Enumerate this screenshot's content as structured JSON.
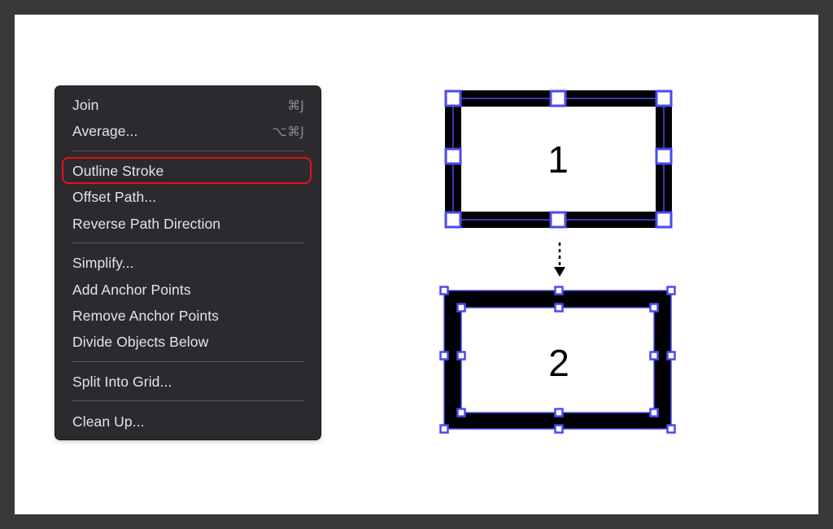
{
  "context_menu": {
    "items": [
      {
        "label": "Join",
        "shortcut": "⌘J"
      },
      {
        "label": "Average...",
        "shortcut": "⌥⌘J"
      },
      {
        "label": "Outline Stroke",
        "shortcut": "",
        "highlighted": true
      },
      {
        "label": "Offset Path...",
        "shortcut": ""
      },
      {
        "label": "Reverse Path Direction",
        "shortcut": ""
      },
      {
        "label": "Simplify...",
        "shortcut": ""
      },
      {
        "label": "Add Anchor Points",
        "shortcut": ""
      },
      {
        "label": "Remove Anchor Points",
        "shortcut": ""
      },
      {
        "label": "Divide Objects Below",
        "shortcut": ""
      },
      {
        "label": "Split Into Grid...",
        "shortcut": ""
      },
      {
        "label": "Clean Up...",
        "shortcut": ""
      }
    ],
    "highlight_color": "#e0121b"
  },
  "illustration": {
    "before_label": "1",
    "after_label": "2",
    "selection_color": "#4a4af0",
    "stroke_color": "#000000"
  }
}
